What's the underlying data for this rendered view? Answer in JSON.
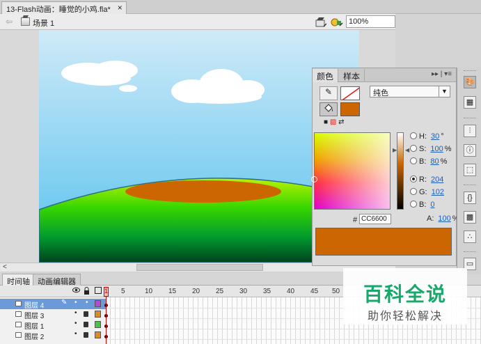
{
  "document_tab": {
    "title": "13-Flash动画：睡觉的小鸡.fla*",
    "close": "×"
  },
  "edit_bar": {
    "back": "⇦",
    "scene": "场景 1",
    "zoom": "100%"
  },
  "scroll": {
    "left_arrow": "<"
  },
  "timeline": {
    "tabs": [
      "时间轴",
      "动画编辑器"
    ],
    "frame_numbers": [
      "1",
      "5",
      "10",
      "15",
      "20",
      "25",
      "30",
      "35",
      "40",
      "45",
      "50"
    ],
    "layers": [
      {
        "name": "图层 4",
        "selected": true,
        "color": "#b44ad6"
      },
      {
        "name": "图层 3",
        "selected": false,
        "color": "#e08a22"
      },
      {
        "name": "图层 1",
        "selected": false,
        "color": "#45c64a"
      },
      {
        "name": "图层 2",
        "selected": false,
        "color": "#e08a22"
      }
    ]
  },
  "color_panel": {
    "tabs": [
      "颜色",
      "样本"
    ],
    "fill_type": "纯色",
    "fill_color": "#cc6600",
    "channels": [
      {
        "label": "H:",
        "value": "30",
        "unit": "°",
        "selected": false
      },
      {
        "label": "S:",
        "value": "100",
        "unit": "%",
        "selected": false
      },
      {
        "label": "B:",
        "value": "80",
        "unit": "%",
        "selected": false
      },
      {
        "label": "R:",
        "value": "204",
        "unit": "",
        "selected": true
      },
      {
        "label": "G:",
        "value": "102",
        "unit": "",
        "selected": false
      },
      {
        "label": "B:",
        "value": "0",
        "unit": "",
        "selected": false
      }
    ],
    "hex_label": "#",
    "hex": "CC6600",
    "alpha_label": "A:",
    "alpha": "100",
    "alpha_unit": "%"
  },
  "watermark": {
    "title": "百科全说",
    "subtitle": "助你轻松解决"
  },
  "colors": {
    "sky_top": "#c9e8f7",
    "sky_bottom": "#5cc3ee",
    "ground_top": "#aaf000",
    "ground_bottom": "#00551f",
    "ellipse": "#cc6600"
  }
}
